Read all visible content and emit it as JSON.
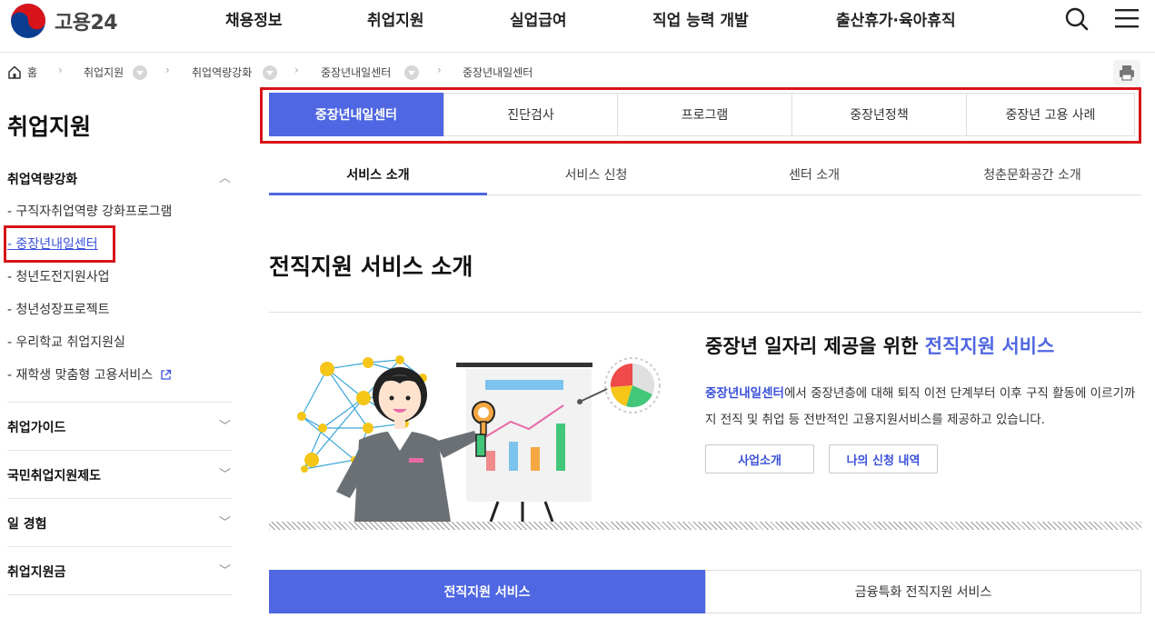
{
  "header": {
    "logo_text": "고용24",
    "nav": [
      "채용정보",
      "취업지원",
      "실업급여",
      "직업 능력 개발",
      "출산휴가·육아휴직"
    ],
    "icons": {
      "search": "search-icon",
      "menu": "hamburger-menu-icon"
    }
  },
  "breadcrumb": {
    "home": "홈",
    "items": [
      "취업지원",
      "취업역량강화",
      "중장년내일센터",
      "중장년내일센터"
    ]
  },
  "sidebar": {
    "title": "취업지원",
    "groups": [
      "취업역량강화",
      "취업가이드",
      "국민취업지원제도",
      "일 경험",
      "취업지원금"
    ],
    "subitems": [
      "- 구직자취업역량 강화프로그램",
      "- 중장년내일센터",
      "- 청년도전지원사업",
      "- 청년성장프로젝트",
      "- 우리학교 취업지원실",
      "- 재학생 맞춤형 고용서비스"
    ]
  },
  "top_tabs": [
    "중장년내일센터",
    "진단검사",
    "프로그램",
    "중장년정책",
    "중장년 고용 사례"
  ],
  "sub_tabs": [
    "서비스 소개",
    "서비스 신청",
    "센터 소개",
    "청춘문화공간 소개"
  ],
  "content": {
    "section_title": "전직지원 서비스 소개",
    "heading_prefix": "중장년 일자리 제공을 위한 ",
    "heading_highlight": "전직지원 서비스",
    "desc_keyword": "중장년내일센터",
    "desc_rest": "에서 중장년층에 대해 퇴직 이전 단계부터 이후 구직 활동에 이르기까지 전직 및 취업 등 전반적인 고용지원서비스를 제공하고 있습니다.",
    "buttons": [
      "사업소개",
      "나의 신청 내역"
    ]
  },
  "bottom_tabs": [
    "전직지원 서비스",
    "금융특화 전직지원 서비스"
  ],
  "colors": {
    "accent": "#4f67e2",
    "link": "#3a50d9",
    "highlight_box": "#d7141a"
  }
}
